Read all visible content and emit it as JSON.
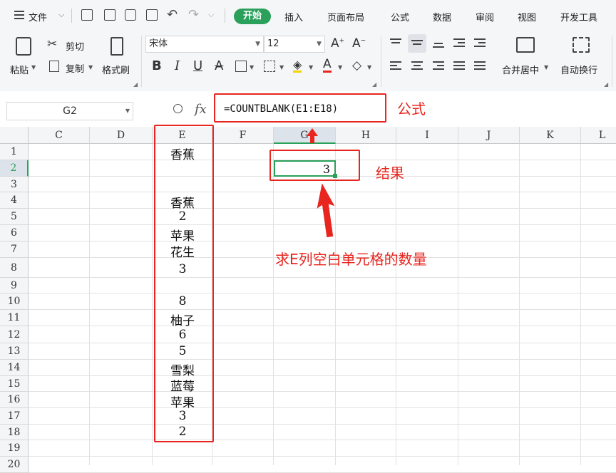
{
  "menu": {
    "hamburger_icon": "menu-icon",
    "file_label": "文件",
    "tabs": [
      "开始",
      "插入",
      "页面布局",
      "公式",
      "数据",
      "审阅",
      "视图",
      "开发工具"
    ]
  },
  "ribbon": {
    "paste": "粘贴",
    "cut": "剪切",
    "copy": "复制",
    "format_painter": "格式刷",
    "font_name": "宋体",
    "font_size": "12",
    "merge_center": "合并居中",
    "auto_wrap": "自动换行"
  },
  "formula_bar": {
    "name_box": "G2",
    "fx": "fx",
    "formula": "=COUNTBLANK(E1:E18)"
  },
  "columns": [
    "C",
    "D",
    "E",
    "F",
    "G",
    "H",
    "I",
    "J",
    "K",
    "L"
  ],
  "rows": [
    "1",
    "2",
    "3",
    "4",
    "5",
    "6",
    "7",
    "8",
    "9",
    "10",
    "11",
    "12",
    "13",
    "14",
    "15",
    "16",
    "17",
    "18",
    "19",
    "20"
  ],
  "column_e": [
    "香蕉",
    "",
    "",
    "香蕉",
    "2",
    "苹果",
    "花生",
    "3",
    "",
    "8",
    "柚子",
    "6",
    "5",
    "雪梨",
    "蓝莓",
    "苹果",
    "3",
    "2"
  ],
  "result_g2": "3",
  "annotations": {
    "formula_label": "公式",
    "result_label": "结果",
    "explain": "求E列空白单元格的数量"
  },
  "colors": {
    "accent_green": "#2aa05a",
    "annotation_red": "#e8261f"
  }
}
